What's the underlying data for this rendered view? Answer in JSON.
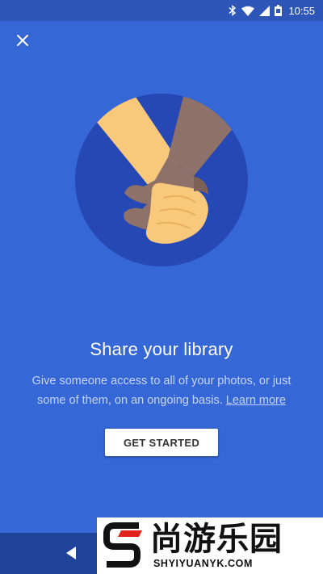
{
  "status_bar": {
    "time": "10:55",
    "icons": [
      "bluetooth-icon",
      "wifi-icon",
      "signal-icon",
      "battery-icon"
    ]
  },
  "dialog": {
    "close_icon": "close-icon",
    "title": "Share your library",
    "description": "Give someone access to all of your photos, or just some of them, on an ongoing basis.",
    "learn_more": "Learn more",
    "get_started": "GET STARTED"
  },
  "nav_bar": {
    "back_icon": "back-triangle-icon"
  },
  "watermark": {
    "chinese_text": "尚游乐园",
    "english_text": "SHYIYUANYK.COM"
  },
  "colors": {
    "background": "#3567d6",
    "status_bar": "#2d56b8",
    "circle": "#2648b5",
    "button_bg": "#ffffff",
    "nav_bar": "#1f4399"
  }
}
